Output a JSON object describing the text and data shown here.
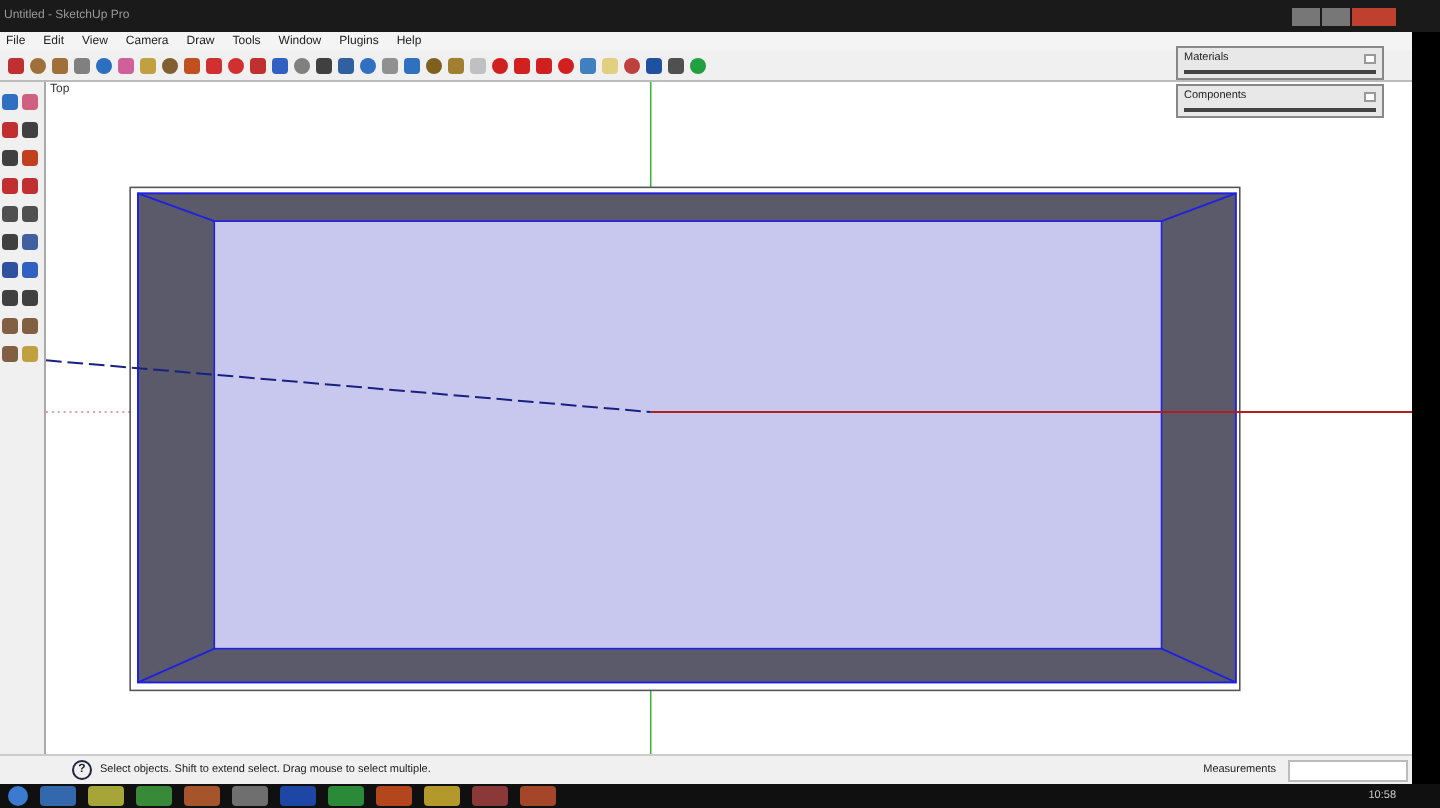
{
  "window": {
    "title": "Untitled - SketchUp Pro"
  },
  "menu": [
    "File",
    "Edit",
    "View",
    "Camera",
    "Draw",
    "Tools",
    "Window",
    "Plugins",
    "Help"
  ],
  "viewport": {
    "view_label": "Top"
  },
  "trays": [
    {
      "title": "Materials"
    },
    {
      "title": "Components"
    }
  ],
  "status_bar": {
    "help_glyph": "?",
    "message": "Select objects. Shift to extend select. Drag mouse to select multiple.",
    "measurements_label": "Measurements"
  },
  "taskbar": {
    "clock": "10:58"
  }
}
